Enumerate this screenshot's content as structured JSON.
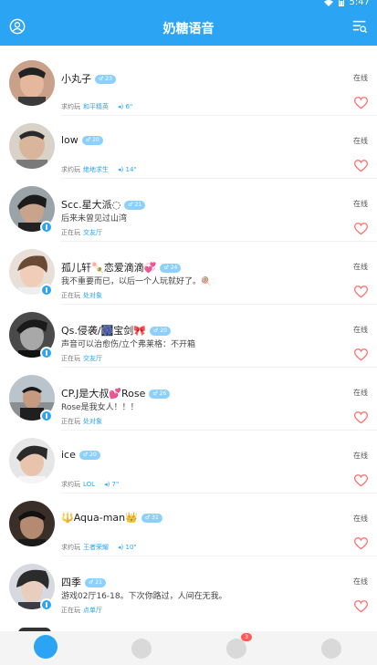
{
  "status_bar": {
    "time": "5:47"
  },
  "header": {
    "title": "奶糖语音"
  },
  "users": [
    {
      "name": "小丸子",
      "age": "23",
      "bio": "",
      "activity_label": "求约玩",
      "game": "和平精英",
      "voice": "6\"",
      "status": "在线"
    },
    {
      "name": "low",
      "age": "20",
      "bio": "",
      "activity_label": "求约玩",
      "game": "绝地求生",
      "voice": "14\"",
      "status": "在线"
    },
    {
      "name": "Scc.星大派◌",
      "age": "21",
      "bio": "后来未曾见过山湾",
      "activity_label": "正在玩",
      "game": "交友厅",
      "voice": "",
      "status": "在线"
    },
    {
      "name": "孤儿轩🍡恋爱滴滴💞",
      "age": "24",
      "bio": "我不重要而已，以后一个人玩就好了。🍭",
      "activity_label": "正在玩",
      "game": "处对象",
      "voice": "",
      "status": "在线"
    },
    {
      "name": "Qs.侵袭/🎆宝剑🎀",
      "age": "20",
      "bio": "声音可以治愈伤/立个弗莱格：不开箱",
      "activity_label": "正在玩",
      "game": "交友厅",
      "voice": "",
      "status": "在线"
    },
    {
      "name": "CP.J是大叔💕Rose",
      "age": "26",
      "bio": "Rose是我女人！！！",
      "activity_label": "正在玩",
      "game": "处对象",
      "voice": "",
      "status": "在线"
    },
    {
      "name": "ice",
      "age": "20",
      "bio": "",
      "activity_label": "求约玩",
      "game": "LOL",
      "voice": "7\"",
      "status": "在线"
    },
    {
      "name": "🔱Aqua-man👑",
      "age": "31",
      "bio": "",
      "activity_label": "求约玩",
      "game": "王者荣耀",
      "voice": "10\"",
      "status": "在线"
    },
    {
      "name": "四季",
      "age": "21",
      "bio": "游戏02厅16-18。下次你路过，人间在无我。",
      "activity_label": "正在玩",
      "game": "点单厅",
      "voice": "",
      "status": "在线"
    }
  ],
  "bottom_nav": {
    "messages_badge": "3"
  },
  "colors": {
    "primary": "#2ba4f3",
    "heart": "#ff6b6b",
    "badge": "#8bd0ff"
  }
}
